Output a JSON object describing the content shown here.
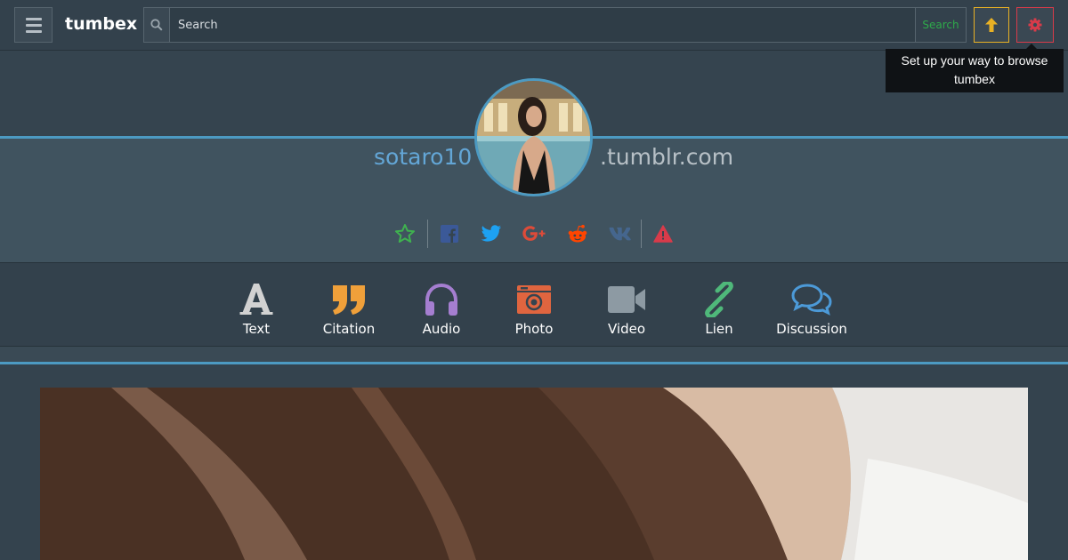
{
  "header": {
    "brand": "tumbex",
    "search_placeholder": "Search",
    "search_button": "Search",
    "icons": [
      "menu-icon",
      "search-icon",
      "arrow-up-icon",
      "gear-icon"
    ],
    "accent_colors": {
      "up": "#e8b125",
      "gear": "#d83b4a",
      "search_button": "#2eaa4a"
    }
  },
  "tooltip": {
    "text": "Set up your way to browse tumbex"
  },
  "profile": {
    "username": "sotaro10",
    "domain_suffix": ".tumblr.com",
    "share_icons": [
      "star-icon",
      "facebook-icon",
      "twitter-icon",
      "google-plus-icon",
      "reddit-icon",
      "vk-icon",
      "warning-icon"
    ],
    "accent_color": "#4c9ac2"
  },
  "post_types": [
    {
      "label": "Text",
      "icon": "text-icon"
    },
    {
      "label": "Citation",
      "icon": "quote-icon"
    },
    {
      "label": "Audio",
      "icon": "headphones-icon"
    },
    {
      "label": "Photo",
      "icon": "camera-icon"
    },
    {
      "label": "Video",
      "icon": "video-camera-icon"
    },
    {
      "label": "Lien",
      "icon": "link-icon"
    },
    {
      "label": "Discussion",
      "icon": "chat-icon"
    }
  ]
}
